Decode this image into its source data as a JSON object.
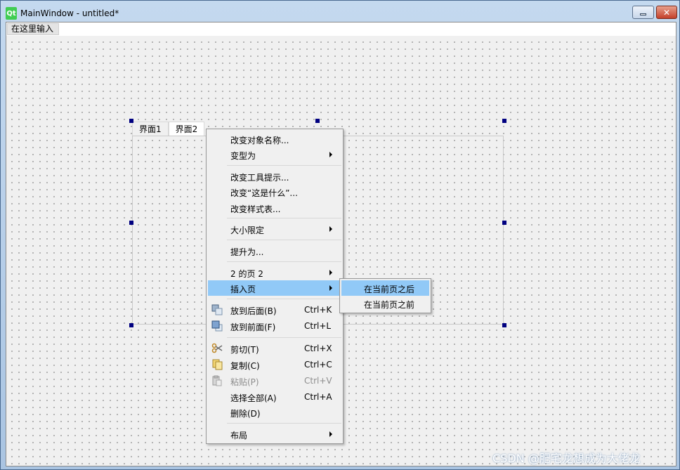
{
  "window": {
    "title": "MainWindow - untitled*",
    "logo_text": "Qt",
    "close_glyph": "✕"
  },
  "menubar": {
    "placeholder_item": "在这里输入"
  },
  "tabwidget": {
    "tabs": [
      {
        "label": "界面1",
        "active": false
      },
      {
        "label": "界面2",
        "active": true
      }
    ]
  },
  "context_menu": {
    "items": [
      {
        "label": "改变对象名称..."
      },
      {
        "label": "变型为",
        "submenu": true
      },
      {
        "label": "改变工具提示..."
      },
      {
        "label": "改变“这是什么”..."
      },
      {
        "label": "改变样式表..."
      },
      {
        "label": "大小限定",
        "submenu": true
      },
      {
        "label": "提升为..."
      },
      {
        "label": "2 的页 2",
        "submenu": true
      },
      {
        "label": "插入页",
        "submenu": true,
        "highlighted": true
      },
      {
        "label": "放到后面(B)",
        "shortcut": "Ctrl+K",
        "icon": "send-to-back-icon"
      },
      {
        "label": "放到前面(F)",
        "shortcut": "Ctrl+L",
        "icon": "bring-to-front-icon"
      },
      {
        "label": "剪切(T)",
        "shortcut": "Ctrl+X",
        "icon": "scissors-icon"
      },
      {
        "label": "复制(C)",
        "shortcut": "Ctrl+C",
        "icon": "copy-icon"
      },
      {
        "label": "粘贴(P)",
        "shortcut": "Ctrl+V",
        "icon": "paste-icon",
        "disabled": true
      },
      {
        "label": "选择全部(A)",
        "shortcut": "Ctrl+A"
      },
      {
        "label": "删除(D)"
      },
      {
        "label": "布局",
        "submenu": true
      }
    ]
  },
  "insert_page_submenu": {
    "items": [
      {
        "label": "在当前页之后",
        "highlighted": true
      },
      {
        "label": "在当前页之前"
      }
    ]
  },
  "watermark": "CSDN @肥宅龙想成为大佬龙",
  "colors": {
    "highlight": "#91c9f7",
    "selection_handle": "#000080",
    "qt_green": "#41cd52"
  }
}
